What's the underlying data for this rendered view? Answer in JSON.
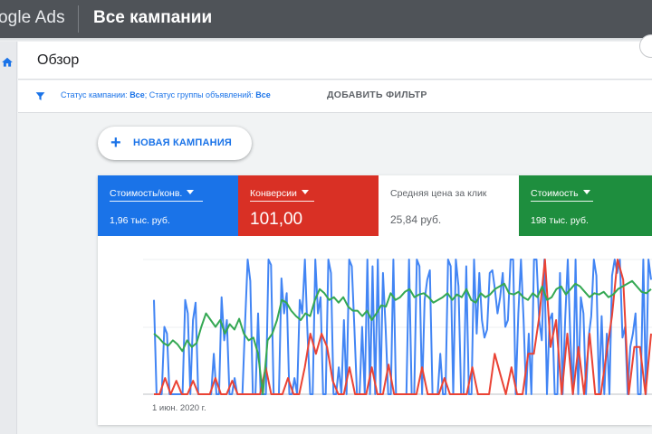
{
  "header": {
    "brand": "ogle Ads",
    "title": "Все кампании"
  },
  "overview": {
    "title": "Обзор"
  },
  "filter": {
    "prefix1": "Статус кампании: ",
    "value1": "Все",
    "prefix2": "; Статус группы объявлений: ",
    "value2": "Все",
    "add_label": "ДОБАВИТЬ ФИЛЬТР"
  },
  "new_campaign": {
    "label": "НОВАЯ КАМПАНИЯ"
  },
  "metrics": [
    {
      "label": "Стоимость/конв.",
      "value": "1,96 тыс. руб.",
      "color": "#1a73e8",
      "dropdown": true
    },
    {
      "label": "Конверсии",
      "value": "101,00",
      "color": "#d93025",
      "dropdown": true
    },
    {
      "label": "Средняя цена за клик",
      "value": "25,84 руб.",
      "color": "#ffffff",
      "dropdown": false
    },
    {
      "label": "Стоимость",
      "value": "198 тыс. руб.",
      "color": "#1e8e3e",
      "dropdown": true
    }
  ],
  "chart_data": {
    "type": "line",
    "x_start_label": "1 июн. 2020 г.",
    "grid": true,
    "series": [
      {
        "color": "#4285f4",
        "values": [
          70,
          0,
          0,
          0,
          50,
          45,
          0,
          0,
          0,
          0,
          0,
          0,
          70,
          60,
          0,
          55,
          68,
          0,
          0,
          0,
          0,
          0,
          0,
          30,
          0,
          0,
          72,
          40,
          55,
          0,
          0,
          12,
          0,
          0,
          0,
          52,
          100,
          84,
          0,
          0,
          60,
          0,
          0,
          0,
          100,
          96,
          0,
          0,
          0,
          86,
          60,
          75,
          0,
          0,
          12,
          0,
          70,
          60,
          100,
          45,
          0,
          0,
          100,
          60,
          72,
          0,
          0,
          100,
          90,
          0,
          0,
          20,
          0,
          55,
          0,
          100,
          95,
          50,
          0,
          0,
          50,
          0,
          100,
          0,
          95,
          0,
          100,
          0,
          90,
          50,
          0,
          0,
          100,
          0,
          0,
          0,
          0,
          0,
          100,
          0,
          0,
          100,
          95,
          0,
          70,
          85,
          92,
          0,
          0,
          0,
          30,
          0,
          0,
          100,
          95,
          0,
          100,
          80,
          0,
          0,
          95,
          0,
          0,
          100,
          45,
          90,
          55,
          42,
          48,
          90,
          92,
          78,
          60,
          72,
          90,
          50,
          55,
          100,
          100,
          0,
          60,
          100,
          55,
          0,
          45,
          0,
          100,
          100,
          55,
          40,
          100,
          0,
          55,
          60,
          0,
          0,
          90,
          0,
          55,
          100,
          40,
          0,
          100,
          0,
          72,
          60,
          0,
          42,
          58,
          100,
          88,
          0,
          58,
          0,
          45,
          0,
          88,
          100,
          90,
          100,
          42,
          50,
          0,
          35,
          45,
          60,
          0,
          0,
          100,
          0,
          100,
          85
        ]
      },
      {
        "color": "#34a853",
        "values": [
          45,
          42,
          38,
          36,
          40,
          37,
          32,
          40,
          35,
          38,
          50,
          60,
          55,
          50,
          55,
          45,
          52,
          48,
          56,
          45,
          40,
          42,
          30,
          0,
          40,
          45,
          55,
          70,
          68,
          62,
          58,
          55,
          60,
          58,
          70,
          78,
          75,
          70,
          72,
          68,
          72,
          65,
          62,
          62,
          58,
          62,
          55,
          60,
          66,
          65,
          75,
          70,
          72,
          76,
          78,
          72,
          74,
          75,
          72,
          68,
          70,
          72,
          75,
          70,
          74,
          72,
          78,
          70,
          68,
          75,
          72,
          74,
          78,
          80,
          82,
          75,
          74,
          76,
          72,
          70,
          75,
          72,
          80,
          70,
          72,
          78,
          80,
          74,
          78,
          82,
          80,
          76,
          72,
          75,
          74,
          76,
          72,
          74,
          78,
          80,
          82,
          84,
          80,
          76,
          75,
          78
        ]
      },
      {
        "color": "#ea4335",
        "values": [
          0,
          0,
          12,
          0,
          10,
          0,
          0,
          10,
          0,
          0,
          0,
          12,
          0,
          0,
          10,
          0,
          0,
          0,
          0,
          0,
          20,
          0,
          0,
          0,
          12,
          0,
          0,
          20,
          45,
          30,
          45,
          35,
          10,
          0,
          0,
          20,
          0,
          0,
          0,
          20,
          0,
          0,
          22,
          0,
          0,
          0,
          0,
          0,
          20,
          0,
          0,
          0,
          12,
          0,
          0,
          0,
          0,
          20,
          0,
          0,
          0,
          30,
          15,
          0,
          20,
          0,
          0,
          30,
          30,
          58,
          100,
          35,
          55,
          0,
          45,
          0,
          35,
          0,
          45,
          0,
          0,
          30,
          58,
          100,
          85,
          0,
          35,
          35,
          0,
          45
        ]
      }
    ]
  }
}
